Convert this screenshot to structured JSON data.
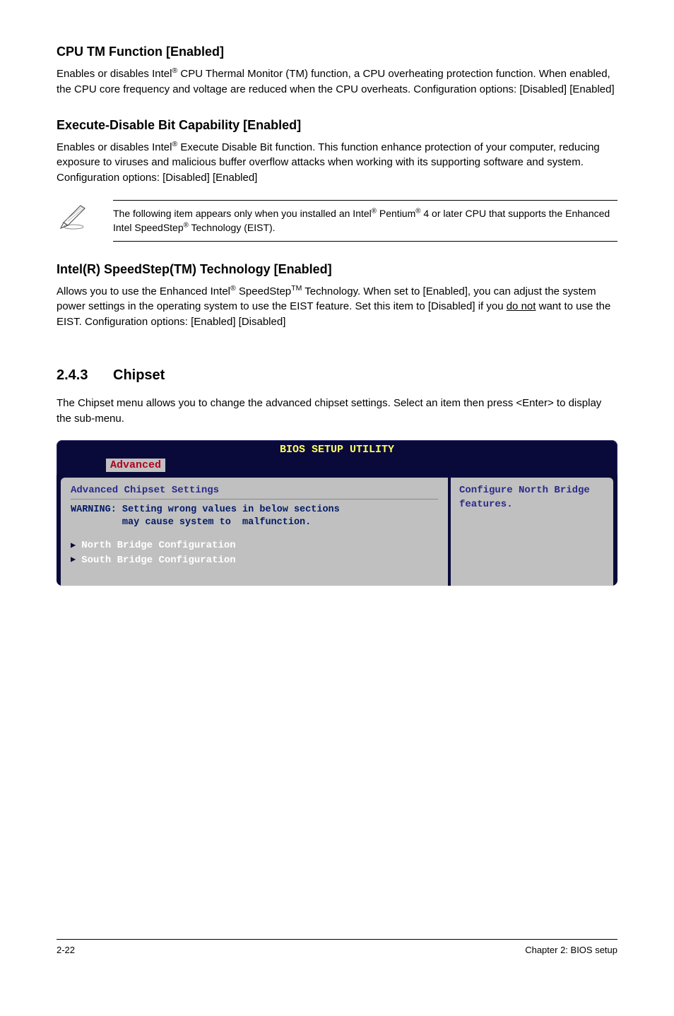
{
  "section1": {
    "heading": "CPU TM Function [Enabled]",
    "body": "Enables or disables Intel® CPU Thermal Monitor (TM) function, a CPU overheating protection function. When enabled, the CPU core frequency and voltage are reduced when the CPU overheats. Configuration options: [Disabled] [Enabled]"
  },
  "section2": {
    "heading": "Execute-Disable Bit Capability [Enabled]",
    "body": "Enables or disables Intel® Execute Disable Bit function. This function enhance protection of your computer, reducing exposure to viruses and malicious buffer overflow attacks when working with its supporting software and system. Configuration options: [Disabled] [Enabled]"
  },
  "note": {
    "text": "The following item appears only when you installed an Intel® Pentium® 4 or later CPU that supports the Enhanced Intel SpeedStep® Technology (EIST)."
  },
  "section3": {
    "heading": "Intel(R) SpeedStep(TM) Technology [Enabled]",
    "body_pre": "Allows you to use the Enhanced Intel® SpeedStep™ Technology. When set to [Enabled], you can adjust the system power settings in the operating system to use the EIST feature. Set this item to [Disabled] if you ",
    "body_underline": "do not",
    "body_post": " want to use the EIST. Configuration options: [Enabled] [Disabled]"
  },
  "chipset": {
    "number": "2.4.3",
    "title": "Chipset",
    "body": "The Chipset menu allows you to change the advanced chipset settings. Select an item then press <Enter> to display the sub-menu."
  },
  "bios": {
    "title": "BIOS SETUP UTILITY",
    "tab": "Advanced",
    "section_title": "Advanced Chipset Settings",
    "warning": "WARNING: Setting wrong values in below sections\n         may cause system to  malfunction.",
    "items": [
      "North Bridge Configuration",
      "South Bridge Configuration"
    ],
    "right_text": "Configure North Bridge features."
  },
  "footer": {
    "left": "2-22",
    "right": "Chapter 2: BIOS setup"
  }
}
